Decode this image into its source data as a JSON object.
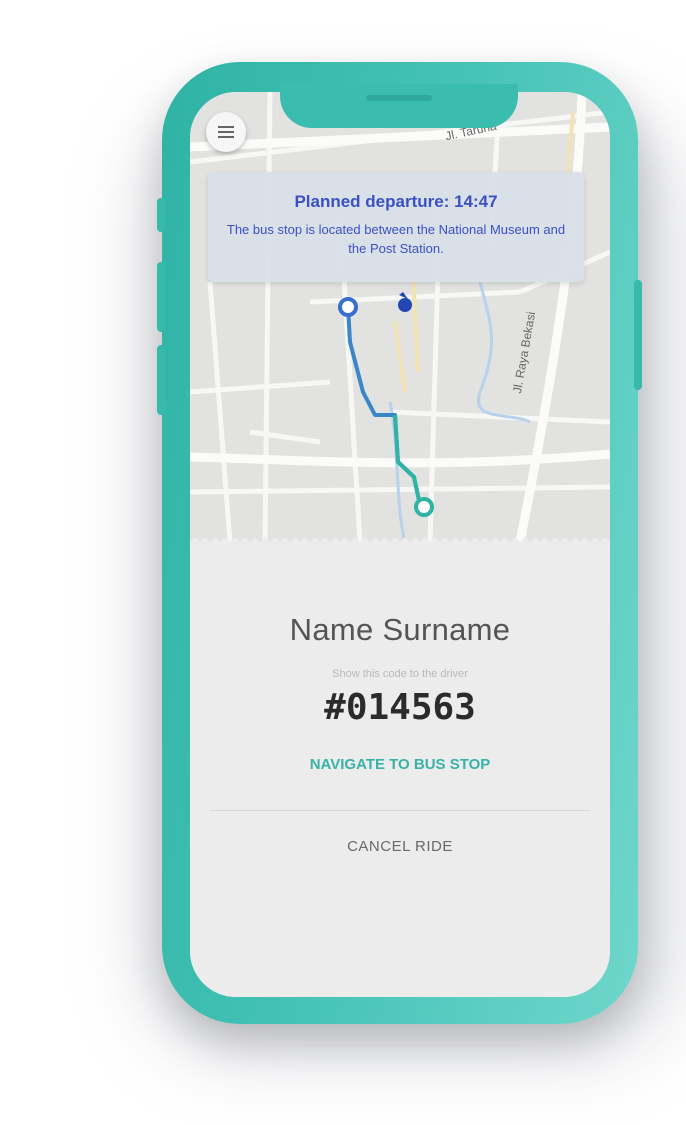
{
  "map": {
    "streets": [
      "Jl. Taruna",
      "Jl. Raya Bekasi"
    ]
  },
  "departure_card": {
    "title": "Planned departure: 14:47",
    "description": "The bus stop is located between the National Museum and the Post Station."
  },
  "ride": {
    "passenger_name": "Name Surname",
    "code_hint": "Show this code to the driver",
    "code": "#014563"
  },
  "actions": {
    "navigate_label": "NAVIGATE TO BUS STOP",
    "cancel_label": "CANCEL RIDE"
  },
  "colors": {
    "phone_frame": "#43c2b5",
    "accent": "#38b3a6",
    "card_text": "#3a50c4",
    "route_start": "#3a7bd5",
    "route_end": "#2fb3a5"
  },
  "icons": [
    "menu-icon",
    "user-location-icon",
    "route-start-marker-icon",
    "route-end-marker-icon"
  ]
}
